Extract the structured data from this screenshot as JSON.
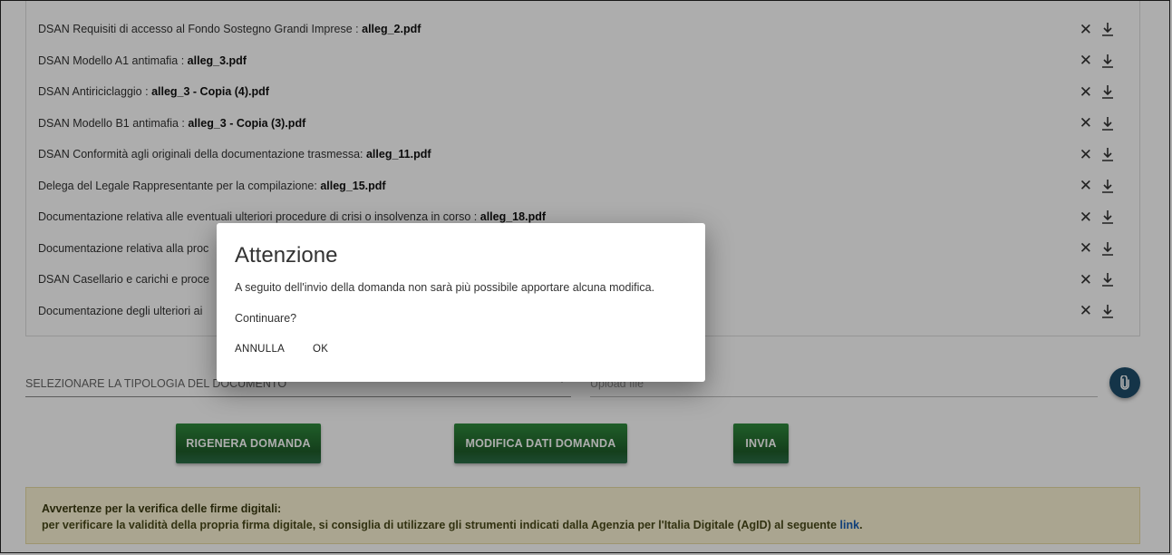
{
  "attachments": [
    {
      "label": "DSAN Requisiti di accesso al Fondo Sostegno Grandi Imprese : ",
      "file": "alleg_2.pdf"
    },
    {
      "label": "DSAN Modello A1 antimafia : ",
      "file": "alleg_3.pdf"
    },
    {
      "label": "DSAN Antiriciclaggio : ",
      "file": "alleg_3 - Copia (4).pdf"
    },
    {
      "label": "DSAN Modello B1 antimafia : ",
      "file": "alleg_3 - Copia (3).pdf"
    },
    {
      "label": "DSAN Conformità agli originali della documentazione trasmessa: ",
      "file": "alleg_11.pdf"
    },
    {
      "label": "Delega del Legale Rappresentante per la compilazione: ",
      "file": "alleg_15.pdf"
    },
    {
      "label": "Documentazione relativa alle eventuali ulteriori procedure di crisi o insolvenza in corso : ",
      "file": "alleg_18.pdf"
    },
    {
      "label": "Documentazione relativa alla proc",
      "file": ""
    },
    {
      "label": "DSAN Casellario e carichi e proce",
      "file": ""
    },
    {
      "label": "Documentazione degli ulteriori ai",
      "file": ""
    }
  ],
  "icons": {
    "remove": "close-icon",
    "download": "download-icon",
    "attach": "paperclip-icon",
    "remove_glyph": "✕"
  },
  "form": {
    "doc_type_select": "SELEZIONARE LA TIPOLOGIA DEL DOCUMENTO",
    "upload_placeholder": "Upload file"
  },
  "buttons": {
    "regenerate": "RIGENERA DOMANDA",
    "modify": "MODIFICA DATI DOMANDA",
    "send": "INVIA"
  },
  "warning": {
    "title": "Avvertenze per la verifica delle firme digitali:",
    "text": "per verificare la validità della propria firma digitale, si consiglia di utilizzare gli strumenti indicati dalla Agenzia per l'Italia Digitale (AgID) al seguente ",
    "link": "link",
    "end": "."
  },
  "dialog": {
    "title": "Attenzione",
    "message": "A seguito dell'invio della domanda non sarà più possibile apportare alcuna modifica.",
    "question": "Continuare?",
    "cancel": "ANNULLA",
    "ok": "OK"
  },
  "colors": {
    "button_green": "#1f5e2a",
    "fab": "#1e4d6b",
    "warning_bg": "#fbf3d5",
    "link": "#1a5fb4"
  }
}
